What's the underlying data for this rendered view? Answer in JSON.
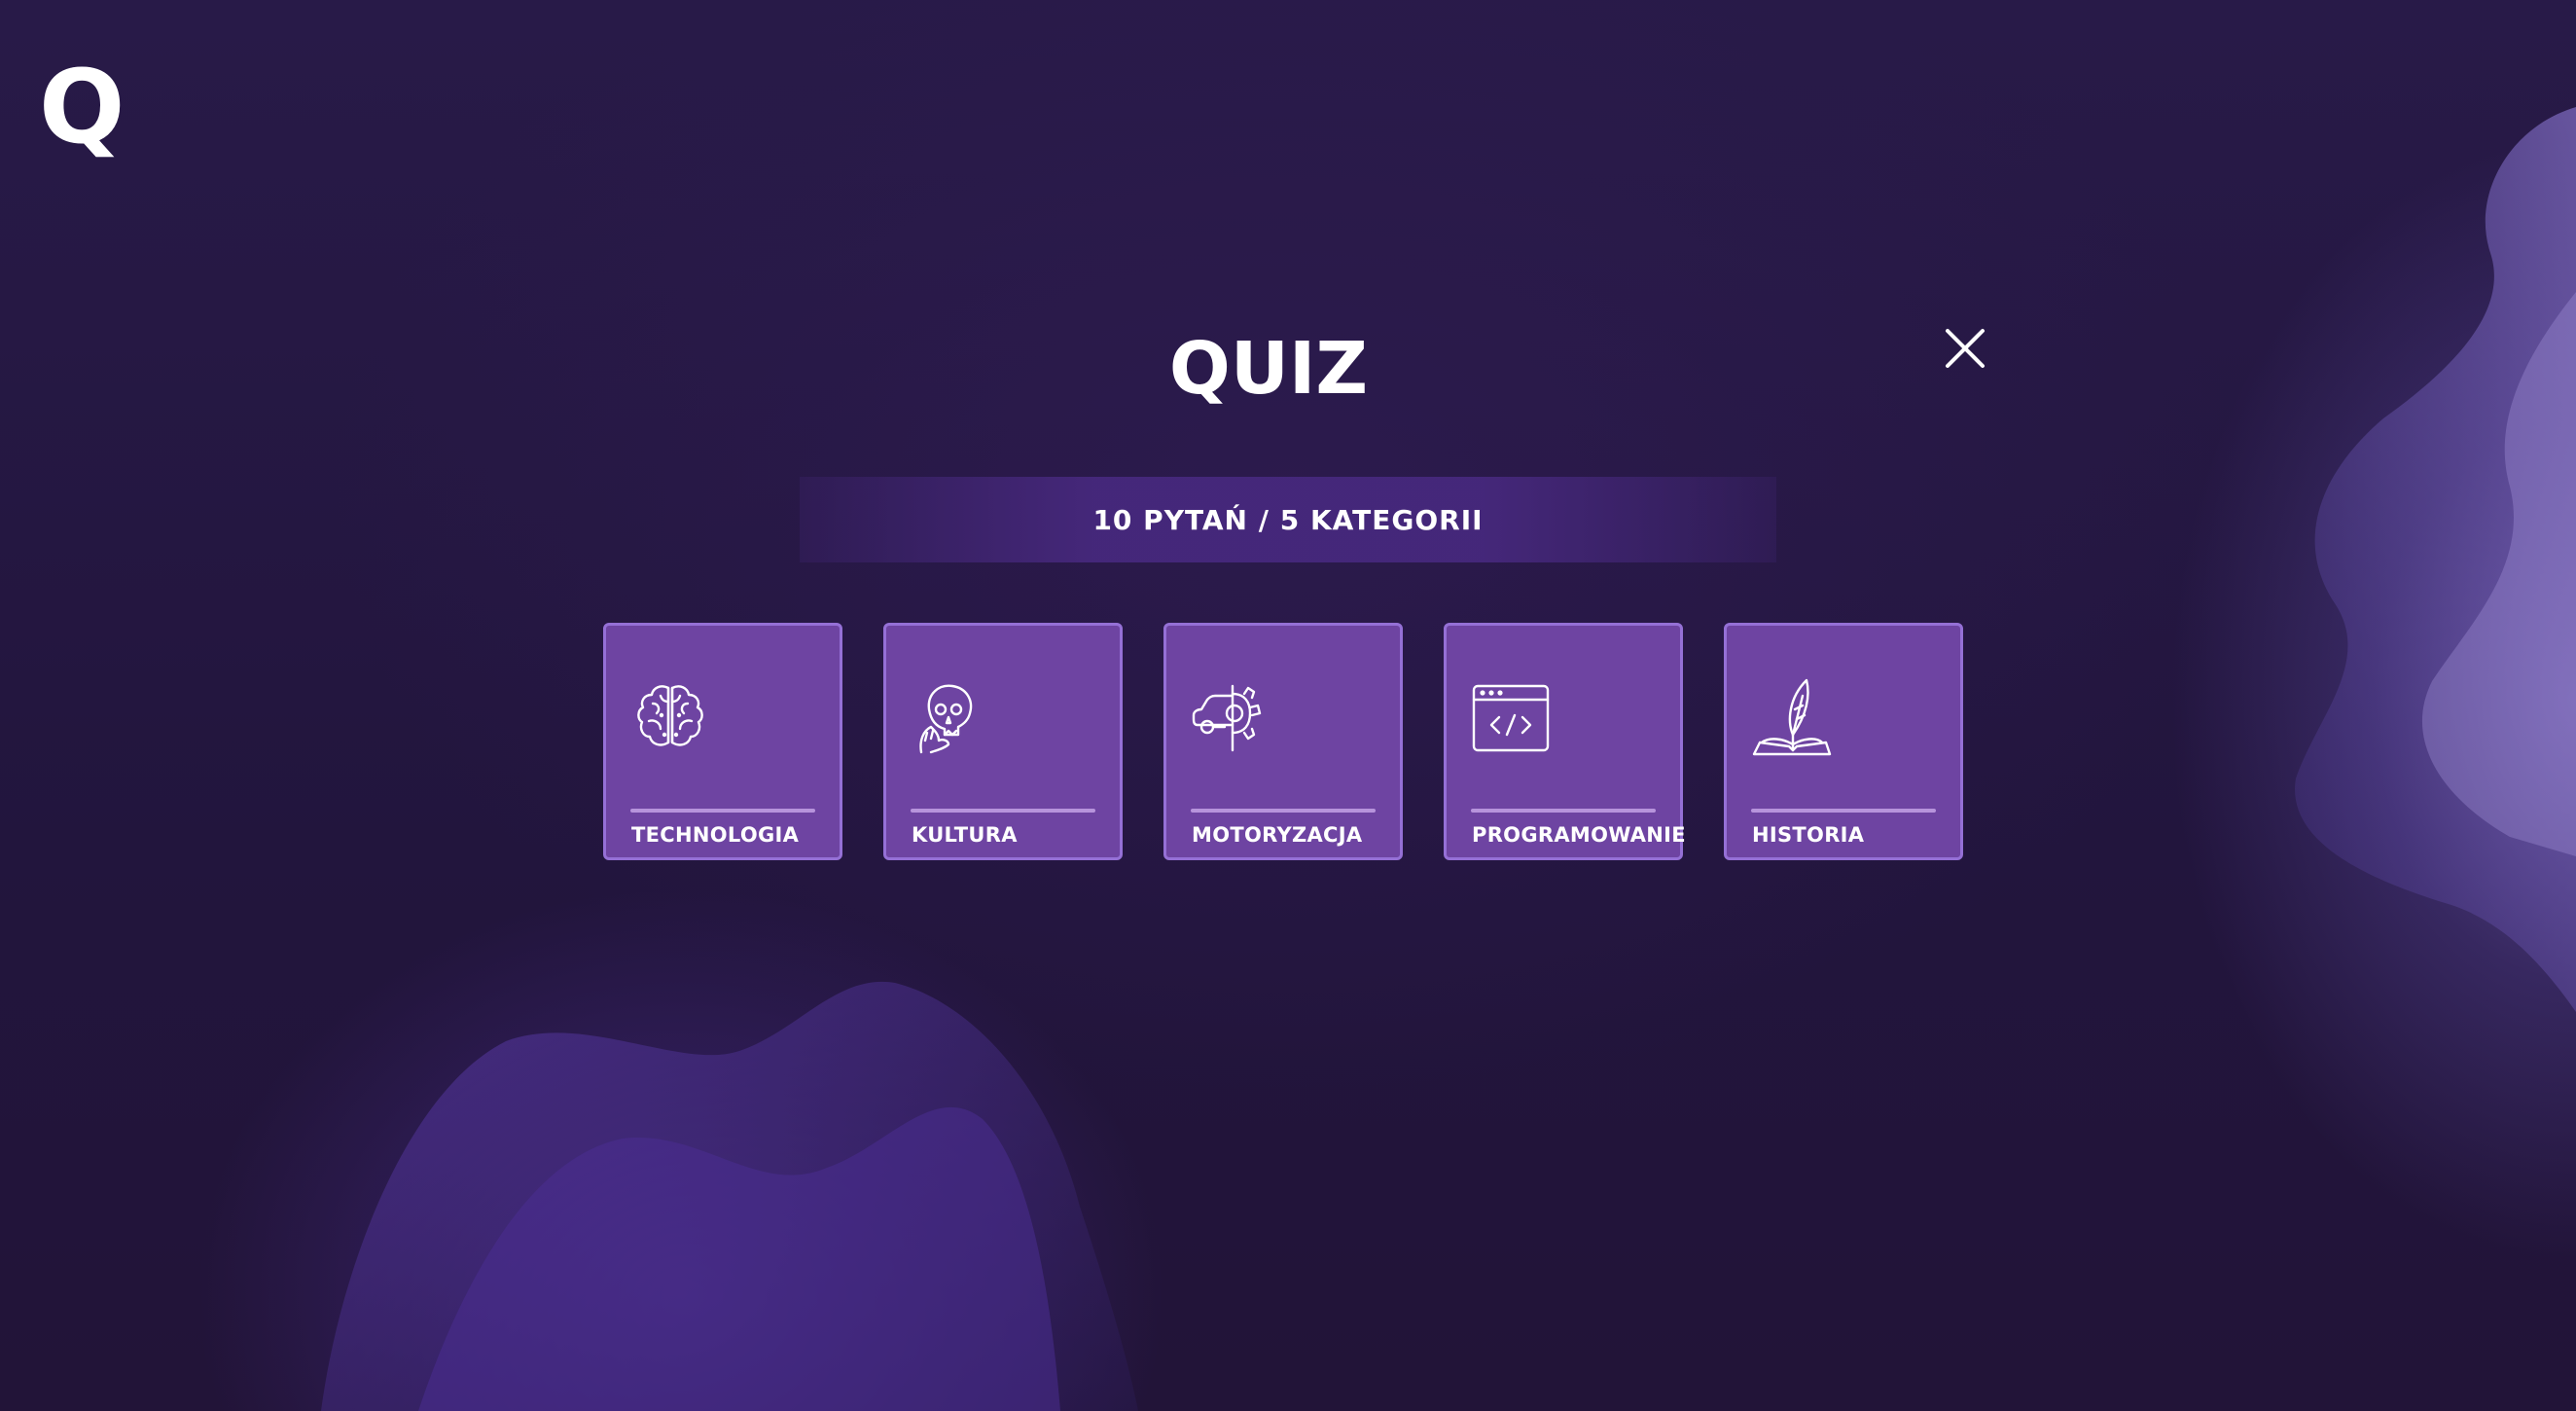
{
  "logo": {
    "text": "Q"
  },
  "quiz": {
    "title": "QUIZ",
    "subtitle": "10 PYTAŃ / 5 KATEGORII"
  },
  "categories": [
    {
      "label": "TECHNOLOGIA",
      "icon": "brain-icon"
    },
    {
      "label": "KULTURA",
      "icon": "skull-hand-icon"
    },
    {
      "label": "MOTORYZACJA",
      "icon": "car-gear-icon"
    },
    {
      "label": "PROGRAMOWANIE",
      "icon": "code-window-icon"
    },
    {
      "label": "HISTORIA",
      "icon": "quill-book-icon"
    }
  ],
  "colors": {
    "background": "#241640",
    "card": "#6e44a2",
    "card_border": "#9570d6",
    "banner": "#46287c",
    "text": "#ffffff"
  }
}
